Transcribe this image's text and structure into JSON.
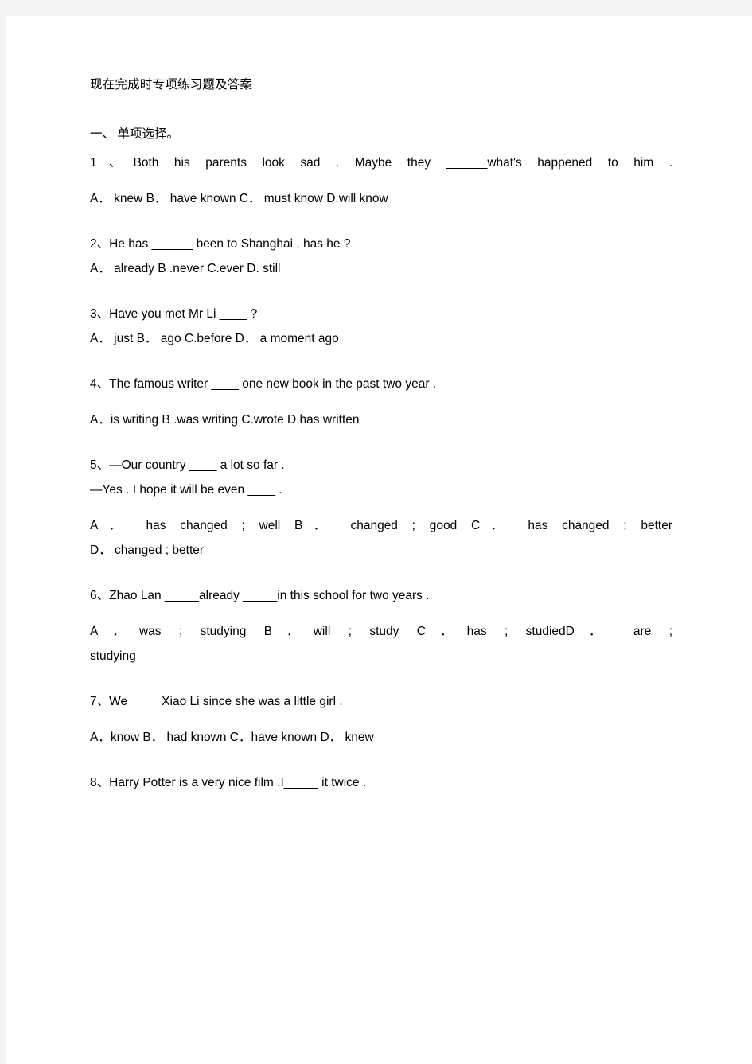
{
  "document": {
    "title": "现在完成时专项练习题及答案",
    "section_heading": "一、\t单项选择。"
  },
  "questions": [
    {
      "number": "1",
      "stem": "1、Both his parents look sad . Maybe they ______what's happened to him .",
      "options": "A． knew        B． have known      C． must know        D.will know"
    },
    {
      "number": "2",
      "stem": "2、He has ______ been to Shanghai , has he ?",
      "options": "A． already                B .never                 C.ever                         D. still"
    },
    {
      "number": "3",
      "stem": "3、Have you met Mr Li ____ ?",
      "options": "A． just            B． ago             C.before          D． a moment ago"
    },
    {
      "number": "4",
      "stem": "4、The famous writer ____ one new book in the past two year .",
      "options": "A．is writing        B .was writing            C.wrote          D.has written"
    },
    {
      "number": "5",
      "stem_line1": "5、—Our country  ____ a lot so far .",
      "stem_line2": "—Yes . I hope it will be even ____ .",
      "options_line1": "A． has changed ; well B． changed ; good C． has changed ; better",
      "options_line2": "D． changed ; better"
    },
    {
      "number": "6",
      "stem": "6、Zhao Lan _____already    _____in this school for two years .",
      "options_line1": "A．was ; studying B．will ; study C．has ; studied",
      "options_line1_right": "D． are ;",
      "options_line2": "studying"
    },
    {
      "number": "7",
      "stem": "7、We ____ Xiao Li since she was a little girl .",
      "options": "A．know        B． had known        C．have known        D． knew"
    },
    {
      "number": "8",
      "stem": "8、Harry Potter is a very nice film .I_____ it twice .",
      "options": ""
    }
  ]
}
